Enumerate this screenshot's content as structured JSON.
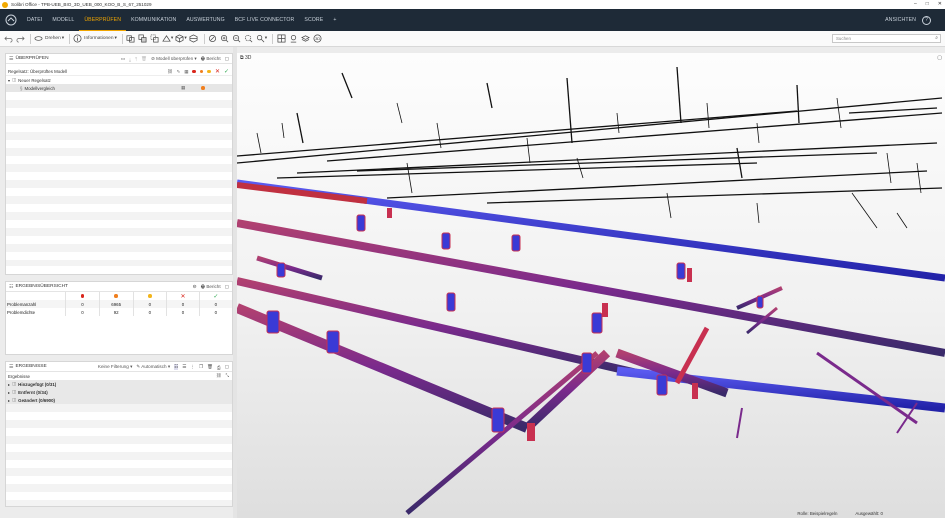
{
  "window": {
    "title": "Solibri Office - TPB-UEB_BIO_3D_UEB_000_KOO_B_S_67_251029",
    "controls": [
      "–",
      "□",
      "✕"
    ]
  },
  "menu": {
    "items": [
      "DATEI",
      "MODELL",
      "ÜBERPRÜFEN",
      "KOMMUNIKATION",
      "AUSWERTUNG",
      "BCF LIVE CONNECTOR",
      "SCORE"
    ],
    "active": "ÜBERPRÜFEN",
    "add": "+",
    "right_label": "ANSICHTEN",
    "help": "?"
  },
  "toolbar": {
    "rotate_label": "Drehen",
    "info_label": "Informationen",
    "search_placeholder": "Suchen"
  },
  "check_panel": {
    "title": "ÜBERPRÜFEN",
    "check_model_label": "Modell überprüfen",
    "report_label": "Bericht",
    "ruleset_label": "Regelsatz: Überprüftes Modell",
    "tree": [
      {
        "label": "Neuer Regelsatz",
        "level": 0
      },
      {
        "label": "Modellvergleich",
        "level": 1
      }
    ]
  },
  "overview_panel": {
    "title": "ERGEBNISÜBERSICHT",
    "report_label": "Bericht",
    "rows": [
      {
        "label": "Problemanzahl",
        "values": [
          "0",
          "6965",
          "0",
          "0",
          "0"
        ]
      },
      {
        "label": "Problemdichte",
        "values": [
          "0",
          "92",
          "0",
          "0",
          "0"
        ]
      }
    ]
  },
  "results_panel": {
    "title": "ERGEBNISSE",
    "filter_label": "Keine Filterung",
    "auto_label": "Automatisch",
    "results_label": "Ergebnisse",
    "groups": [
      "Hinzugefügt (0/31)",
      "Entfernt (0/34)",
      "Geändert (0/6900)"
    ]
  },
  "viewport": {
    "label": "3D"
  },
  "status": {
    "role": "Rolle: Beispielregeln",
    "selected": "Ausgewählt: 0"
  },
  "colors": {
    "accent": "#f0a500",
    "menubar": "#1e2a37",
    "severity_high": "#d9261c",
    "severity_mid": "#f07f1e",
    "severity_low": "#f3b51b",
    "reject": "#d9261c",
    "accept": "#2fa84f",
    "pipe_blue": "#3a3ad6",
    "pipe_red": "#c82a3a",
    "pipe_purple": "#7a2a8c"
  }
}
